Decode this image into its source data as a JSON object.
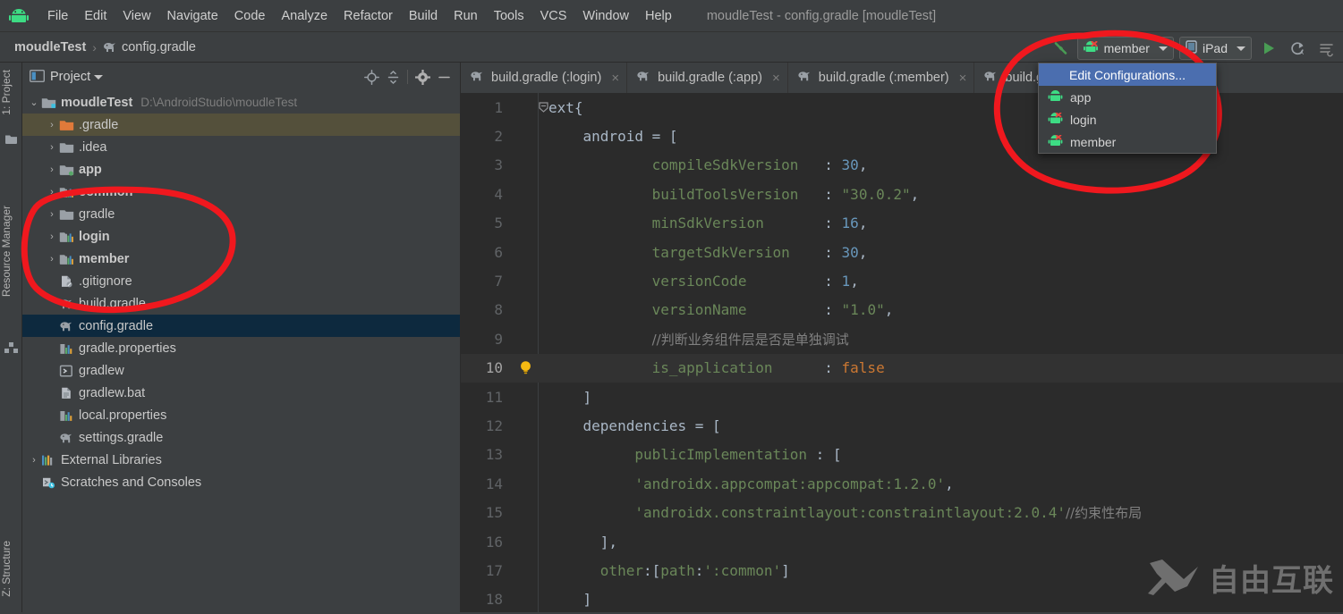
{
  "app": {
    "logo_icon": "android-logo-icon",
    "window_title": "moudleTest - config.gradle [moudleTest]"
  },
  "menubar": {
    "items": [
      {
        "label": "File"
      },
      {
        "label": "Edit"
      },
      {
        "label": "View"
      },
      {
        "label": "Navigate"
      },
      {
        "label": "Code"
      },
      {
        "label": "Analyze"
      },
      {
        "label": "Refactor"
      },
      {
        "label": "Build"
      },
      {
        "label": "Run"
      },
      {
        "label": "Tools"
      },
      {
        "label": "VCS"
      },
      {
        "label": "Window"
      },
      {
        "label": "Help"
      }
    ]
  },
  "breadcrumb": {
    "project": "moudleTest",
    "separator": "›",
    "file_icon": "gradle-elephant-icon",
    "file": "config.gradle"
  },
  "runbar": {
    "build_icon": "hammer-icon",
    "config_icon": "android-module-error-icon",
    "config_label": "member",
    "device_icon": "device-icon",
    "device_label": "iPad",
    "run_icon": "run-play-icon",
    "apply_changes_icon": "apply-changes-icon",
    "more_icon": "run-more-icon"
  },
  "config_menu": {
    "edit_label": "Edit Configurations...",
    "items": [
      {
        "label": "app",
        "icon": "android-module-icon"
      },
      {
        "label": "login",
        "icon": "android-module-error-icon"
      },
      {
        "label": "member",
        "icon": "android-module-error-icon"
      }
    ]
  },
  "toolstrip": {
    "top": [
      {
        "label": "1: Project",
        "icon": "project-tool-icon"
      },
      {
        "label": "Resource Manager",
        "icon": "resource-manager-icon"
      }
    ],
    "bottom": [
      {
        "label": "Z: Structure",
        "icon": "structure-icon"
      }
    ]
  },
  "project_panel": {
    "view_icon": "project-view-icon",
    "title": "Project",
    "caret_icon": "chevron-down-icon",
    "actions": [
      {
        "name": "locate-icon"
      },
      {
        "name": "collapse-all-icon"
      },
      {
        "name": "gear-icon"
      },
      {
        "name": "minimize-icon"
      }
    ],
    "tree": [
      {
        "arrow": "⌄",
        "icon": "module-root-icon",
        "name": "moudleTest",
        "bold": true,
        "path": "D:\\AndroidStudio\\moudleTest",
        "indent": 0,
        "state": "normal"
      },
      {
        "arrow": "›",
        "icon": "folder-orange-icon",
        "name": ".gradle",
        "bold": false,
        "path": "",
        "indent": 1,
        "state": "highlight"
      },
      {
        "arrow": "›",
        "icon": "folder-icon",
        "name": ".idea",
        "bold": false,
        "path": "",
        "indent": 1,
        "state": "normal"
      },
      {
        "arrow": "›",
        "icon": "module-app-icon",
        "name": "app",
        "bold": true,
        "path": "",
        "indent": 1,
        "state": "normal"
      },
      {
        "arrow": "›",
        "icon": "module-lib-icon",
        "name": "common",
        "bold": true,
        "path": "",
        "indent": 1,
        "state": "normal"
      },
      {
        "arrow": "›",
        "icon": "folder-icon",
        "name": "gradle",
        "bold": false,
        "path": "",
        "indent": 1,
        "state": "normal"
      },
      {
        "arrow": "›",
        "icon": "module-lib-icon",
        "name": "login",
        "bold": true,
        "path": "",
        "indent": 1,
        "state": "normal"
      },
      {
        "arrow": "›",
        "icon": "module-lib-icon",
        "name": "member",
        "bold": true,
        "path": "",
        "indent": 1,
        "state": "normal"
      },
      {
        "arrow": "",
        "icon": "gitignore-icon",
        "name": ".gitignore",
        "bold": false,
        "path": "",
        "indent": 1,
        "state": "normal"
      },
      {
        "arrow": "",
        "icon": "gradle-elephant-icon",
        "name": "build.gradle",
        "bold": false,
        "path": "",
        "indent": 1,
        "state": "normal"
      },
      {
        "arrow": "",
        "icon": "gradle-elephant-icon",
        "name": "config.gradle",
        "bold": false,
        "path": "",
        "indent": 1,
        "state": "selected"
      },
      {
        "arrow": "",
        "icon": "properties-icon",
        "name": "gradle.properties",
        "bold": false,
        "path": "",
        "indent": 1,
        "state": "normal"
      },
      {
        "arrow": "",
        "icon": "script-icon",
        "name": "gradlew",
        "bold": false,
        "path": "",
        "indent": 1,
        "state": "normal"
      },
      {
        "arrow": "",
        "icon": "bat-file-icon",
        "name": "gradlew.bat",
        "bold": false,
        "path": "",
        "indent": 1,
        "state": "normal"
      },
      {
        "arrow": "",
        "icon": "properties-icon",
        "name": "local.properties",
        "bold": false,
        "path": "",
        "indent": 1,
        "state": "normal"
      },
      {
        "arrow": "",
        "icon": "gradle-elephant-icon",
        "name": "settings.gradle",
        "bold": false,
        "path": "",
        "indent": 1,
        "state": "normal"
      },
      {
        "arrow": "›",
        "icon": "external-libraries-icon",
        "name": "External Libraries",
        "bold": false,
        "path": "",
        "indent": 0,
        "state": "normal"
      },
      {
        "arrow": "",
        "icon": "scratches-icon",
        "name": "Scratches and Consoles",
        "bold": false,
        "path": "",
        "indent": 0,
        "state": "normal"
      }
    ]
  },
  "editor": {
    "tabs": [
      {
        "label": "build.gradle (:login)",
        "icon": "gradle-elephant-icon",
        "close": "×"
      },
      {
        "label": "build.gradle (:app)",
        "icon": "gradle-elephant-icon",
        "close": "×"
      },
      {
        "label": "build.gradle (:member)",
        "icon": "gradle-elephant-icon",
        "close": "×"
      },
      {
        "label": "build.gradle",
        "icon": "gradle-elephant-icon",
        "close": "×"
      }
    ],
    "current_line": 10,
    "bulb_icon": "intention-bulb-icon",
    "lines": [
      {
        "n": 1,
        "fold": "⊖",
        "html": "<span class=\"k\">ext{</span>"
      },
      {
        "n": 2,
        "fold": "",
        "html": "    <span class=\"k\">android = [</span>"
      },
      {
        "n": 3,
        "fold": "",
        "html": "            <span class=\"prop\">compileSdkVersion</span>   <span class=\"k\">:</span> <span class=\"num\">30</span><span class=\"k\">,</span>"
      },
      {
        "n": 4,
        "fold": "",
        "html": "            <span class=\"prop\">buildToolsVersion</span>   <span class=\"k\">:</span> <span class=\"str\">\"30.0.2\"</span><span class=\"k\">,</span>"
      },
      {
        "n": 5,
        "fold": "",
        "html": "            <span class=\"prop\">minSdkVersion</span>       <span class=\"k\">:</span> <span class=\"num\">16</span><span class=\"k\">,</span>"
      },
      {
        "n": 6,
        "fold": "",
        "html": "            <span class=\"prop\">targetSdkVersion</span>    <span class=\"k\">:</span> <span class=\"num\">30</span><span class=\"k\">,</span>"
      },
      {
        "n": 7,
        "fold": "",
        "html": "            <span class=\"prop\">versionCode</span>         <span class=\"k\">:</span> <span class=\"num\">1</span><span class=\"k\">,</span>"
      },
      {
        "n": 8,
        "fold": "",
        "html": "            <span class=\"prop\">versionName</span>         <span class=\"k\">:</span> <span class=\"str\">\"1.0\"</span><span class=\"k\">,</span>"
      },
      {
        "n": 9,
        "fold": "",
        "html": "            <span class=\"cmt\">//判断业务组件层是否是单独调试</span>"
      },
      {
        "n": 10,
        "fold": "",
        "html": "            <span class=\"prop\">is_application</span>      <span class=\"k\">:</span> <span class=\"kw\">false</span>"
      },
      {
        "n": 11,
        "fold": "",
        "html": "    <span class=\"k\">]</span>"
      },
      {
        "n": 12,
        "fold": "",
        "html": "    <span class=\"k\">dependencies = [</span>"
      },
      {
        "n": 13,
        "fold": "",
        "html": "          <span class=\"prop\">publicImplementation</span> <span class=\"k\">: [</span>"
      },
      {
        "n": 14,
        "fold": "",
        "html": "          <span class=\"str\">'androidx.appcompat:appcompat:1.2.0'</span><span class=\"k\">,</span>"
      },
      {
        "n": 15,
        "fold": "",
        "html": "          <span class=\"str\">'androidx.constraintlayout:constraintlayout:2.0.4'</span><span class=\"cmt\">//约束性布局</span>"
      },
      {
        "n": 16,
        "fold": "",
        "html": "      <span class=\"k\">],</span>"
      },
      {
        "n": 17,
        "fold": "",
        "html": "      <span class=\"prop\">other</span><span class=\"k\">:[</span><span class=\"prop\">path</span><span class=\"k\">:</span><span class=\"str\">':common'</span><span class=\"k\">]</span>"
      },
      {
        "n": 18,
        "fold": "",
        "html": "    <span class=\"k\">]</span>"
      }
    ]
  },
  "annotations": {
    "marker_color": "#f0181e",
    "shapes": [
      "tree-circle-highlight",
      "config-menu-circle-highlight"
    ]
  },
  "watermark": {
    "logo_icon": "x-logo-icon",
    "text": "自由互联"
  },
  "colors": {
    "window_bg": "#3c3f41",
    "editor_bg": "#2b2b2b",
    "selection_blue": "#0d293e",
    "menu_select_blue": "#4b6eaf",
    "accent_green": "#499c54",
    "marker_red": "#f0181e"
  }
}
